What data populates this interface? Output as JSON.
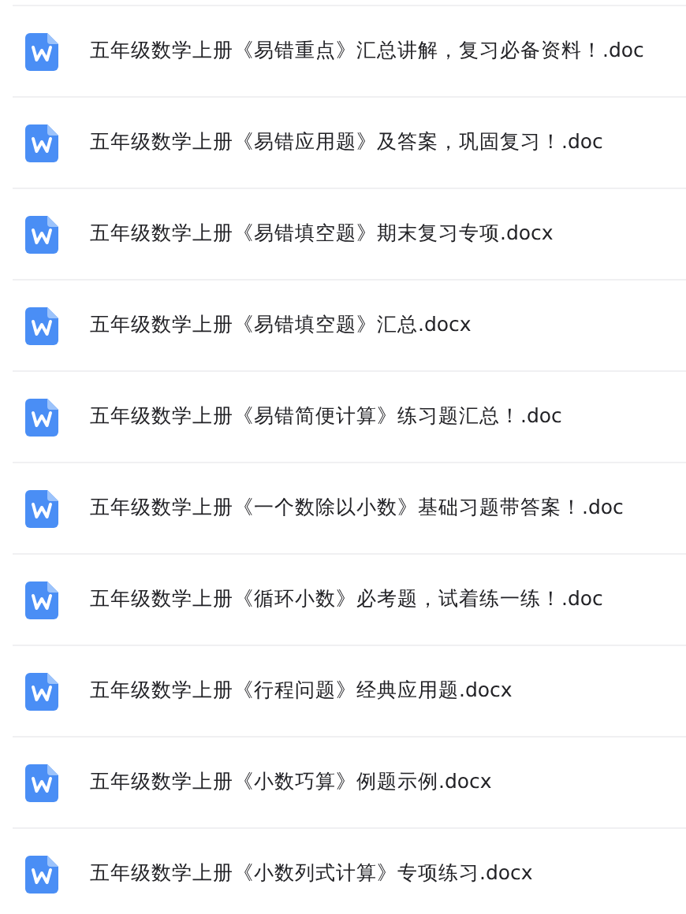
{
  "files": [
    {
      "name": "五年级数学上册《易错重点》汇总讲解，复习必备资料！.doc"
    },
    {
      "name": "五年级数学上册《易错应用题》及答案，巩固复习！.doc"
    },
    {
      "name": "五年级数学上册《易错填空题》期末复习专项.docx"
    },
    {
      "name": "五年级数学上册《易错填空题》汇总.docx"
    },
    {
      "name": "五年级数学上册《易错简便计算》练习题汇总！.doc"
    },
    {
      "name": "五年级数学上册《一个数除以小数》基础习题带答案！.doc"
    },
    {
      "name": "五年级数学上册《循环小数》必考题，试着练一练！.doc"
    },
    {
      "name": "五年级数学上册《行程问题》经典应用题.docx"
    },
    {
      "name": "五年级数学上册《小数巧算》例题示例.docx"
    },
    {
      "name": "五年级数学上册《小数列式计算》专项练习.docx"
    }
  ]
}
